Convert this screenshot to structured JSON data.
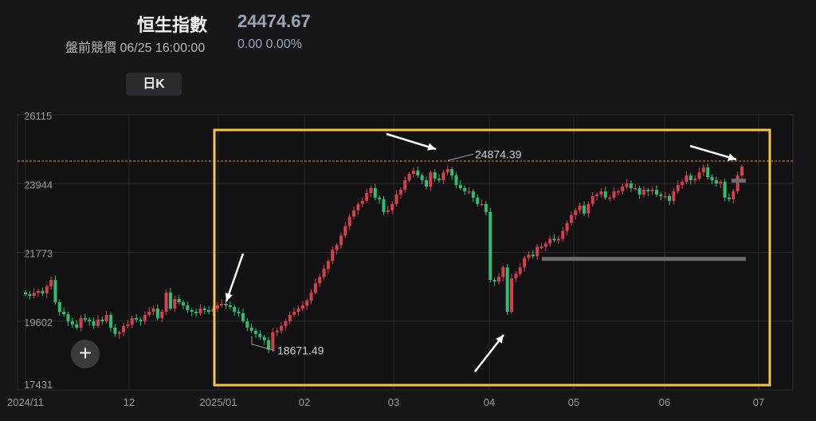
{
  "header": {
    "title": "恒生指數",
    "price": "24474.67",
    "status": "盤前競價 06/25 16:00:00",
    "change": "0.00 0.00%",
    "period_button": "日K"
  },
  "colors": {
    "up": "#d6404c",
    "down": "#2fbf71",
    "highlight": "#f5c542",
    "grid": "#2a2a2e",
    "current_line": "#e07b39",
    "support": "#6b6b6b"
  },
  "icons": {
    "add": "plus-icon"
  },
  "chart_data": {
    "type": "candlestick",
    "title": "",
    "xlabel": "",
    "ylabel": "",
    "ylim": [
      17431,
      26115
    ],
    "y_ticks": [
      "26115",
      "23944",
      "21773",
      "19602",
      "17431"
    ],
    "x_ticks": [
      {
        "label": "2024/11",
        "date": "2024-11-01"
      },
      {
        "label": "12",
        "date": "2024-12-01"
      },
      {
        "label": "2025/01",
        "date": "2025-01-01"
      },
      {
        "label": "02",
        "date": "2025-02-01"
      },
      {
        "label": "03",
        "date": "2025-03-01"
      },
      {
        "label": "04",
        "date": "2025-04-01"
      },
      {
        "label": "05",
        "date": "2025-05-01"
      },
      {
        "label": "06",
        "date": "2025-06-01"
      },
      {
        "label": "07",
        "date": "2025-07-01"
      }
    ],
    "current_price": 24474.67,
    "annotations": [
      {
        "label": "24874.39",
        "value": 24874.39
      },
      {
        "label": "18671.49",
        "value": 18671.49
      }
    ],
    "support_level": 21580,
    "closes": [
      20450,
      20400,
      20500,
      20550,
      20480,
      20700,
      20900,
      20200,
      19900,
      19820,
      19600,
      19500,
      19400,
      19700,
      19650,
      19600,
      19450,
      19650,
      19600,
      19800,
      19400,
      19200,
      19250,
      19450,
      19500,
      19700,
      19650,
      19600,
      19800,
      19900,
      20000,
      19700,
      19900,
      20500,
      20000,
      20300,
      20200,
      20100,
      19950,
      19900,
      19850,
      20000,
      19950,
      19900,
      20000,
      20100,
      20150,
      20100,
      20050,
      19900,
      19850,
      19600,
      19400,
      19300,
      19200,
      19100,
      19000,
      18700,
      19250,
      19300,
      19450,
      19600,
      19800,
      19900,
      20000,
      20100,
      20250,
      20500,
      20800,
      21000,
      21250,
      21500,
      21850,
      22000,
      22300,
      22600,
      22900,
      23100,
      23300,
      23400,
      23650,
      23800,
      23500,
      23450,
      23050,
      23100,
      23300,
      23600,
      23750,
      24050,
      24250,
      24350,
      24200,
      24050,
      23850,
      24300,
      24100,
      24050,
      24300,
      24400,
      24200,
      23900,
      23800,
      23700,
      23700,
      23500,
      23300,
      23300,
      23050,
      20900,
      20850,
      21000,
      21300,
      19900,
      20950,
      21100,
      21300,
      21600,
      21700,
      21650,
      21950,
      21950,
      22050,
      22200,
      22150,
      22200,
      22450,
      22700,
      22950,
      23100,
      23250,
      23000,
      23300,
      23550,
      23600,
      23700,
      23500,
      23500,
      23700,
      23700,
      23850,
      23950,
      23800,
      23800,
      23600,
      23750,
      23700,
      23750,
      23600,
      23550,
      23550,
      23400,
      23700,
      23900,
      24000,
      24200,
      24050,
      24100,
      24300,
      24450,
      24150,
      24050,
      23950,
      24000,
      23500,
      23450,
      23700,
      24200,
      24474.67
    ]
  }
}
